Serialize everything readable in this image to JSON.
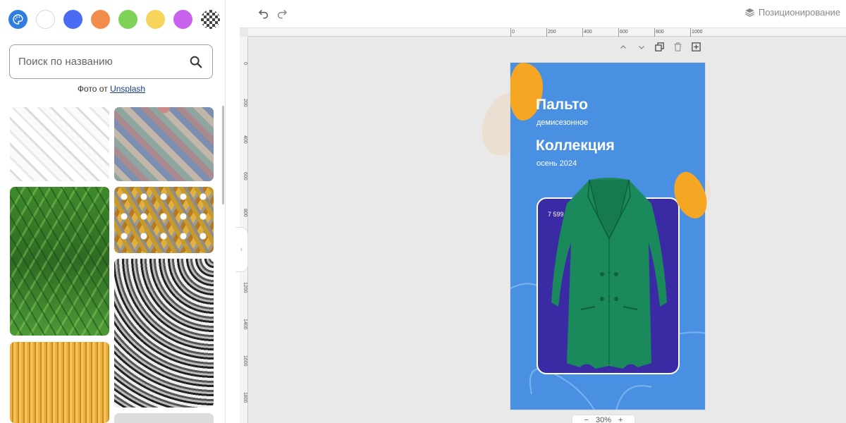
{
  "sidebar": {
    "swatches": [
      {
        "name": "palette",
        "color": "#2f7de1"
      },
      {
        "name": "white",
        "color": "#ffffff"
      },
      {
        "name": "blue",
        "color": "#4a6cf2"
      },
      {
        "name": "orange",
        "color": "#f28c4a"
      },
      {
        "name": "green",
        "color": "#7ed356"
      },
      {
        "name": "yellow",
        "color": "#f7d45c"
      },
      {
        "name": "purple",
        "color": "#c862ec"
      },
      {
        "name": "transparent",
        "color": "checker"
      }
    ],
    "search": {
      "placeholder": "Поиск по названию",
      "icon": "search-icon"
    },
    "credit": {
      "prefix": "Фото от ",
      "link": "Unsplash"
    }
  },
  "topbar": {
    "undo_icon": "undo-icon",
    "redo_icon": "redo-icon",
    "positioning_label": "Позиционирование",
    "positioning_icon": "layers-icon"
  },
  "ruler": {
    "horizontal": [
      "0",
      "200",
      "400",
      "600",
      "800",
      "1000"
    ],
    "vertical": [
      "0",
      "200",
      "400",
      "600",
      "800",
      "1000",
      "1200",
      "1400",
      "1600",
      "1800"
    ]
  },
  "canvas_tools": [
    "move-up-icon",
    "move-down-icon",
    "duplicate-icon",
    "delete-icon",
    "add-icon"
  ],
  "design": {
    "title": "Пальто",
    "subtitle": "демисезонное",
    "title2": "Коллекция",
    "subtitle2": "осень 2024",
    "price": "7 599 ₽",
    "colors": {
      "background": "#4a90e2",
      "accent": "#f5a623",
      "card": "#3a2aa3",
      "coat": "#1a8a5c"
    }
  },
  "zoom": {
    "value": "30%"
  }
}
